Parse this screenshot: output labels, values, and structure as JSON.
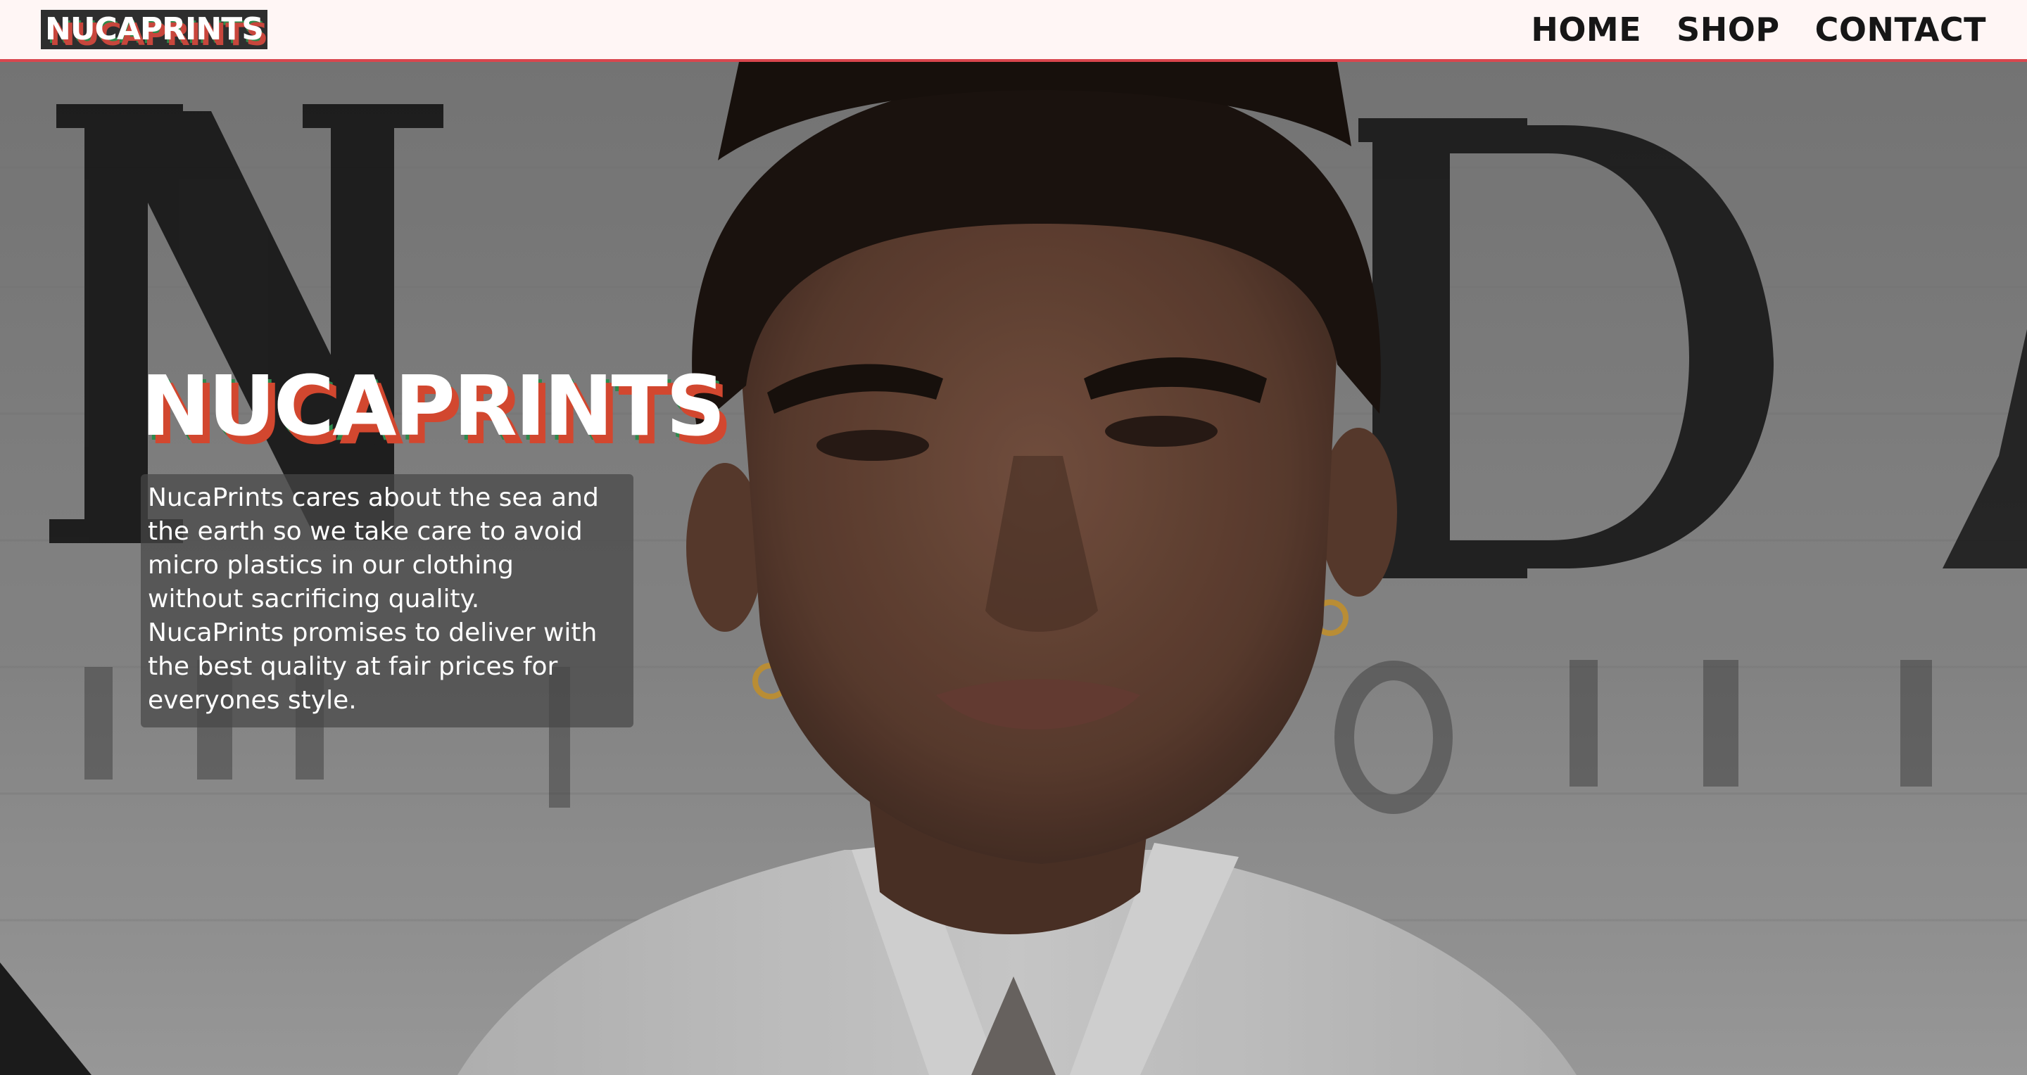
{
  "header": {
    "brand": "NUCAPRINTS",
    "nav": [
      {
        "label": "HOME"
      },
      {
        "label": "SHOP"
      },
      {
        "label": "CONTACT"
      }
    ]
  },
  "hero": {
    "title": "NUCAPRINTS",
    "text_lines": [
      "NucaPrints cares about the sea and",
      "the earth so we take care to avoid",
      "micro plastics in our clothing",
      "without sacrificing quality.",
      "NucaPrints promises to deliver with",
      "the best quality at fair prices for",
      "everyones style."
    ]
  },
  "colors": {
    "header_bg": "#fff6f5",
    "header_border": "#d9464e",
    "title_shadow_red": "#d2472f",
    "title_shadow_green": "#2d8a4d"
  }
}
